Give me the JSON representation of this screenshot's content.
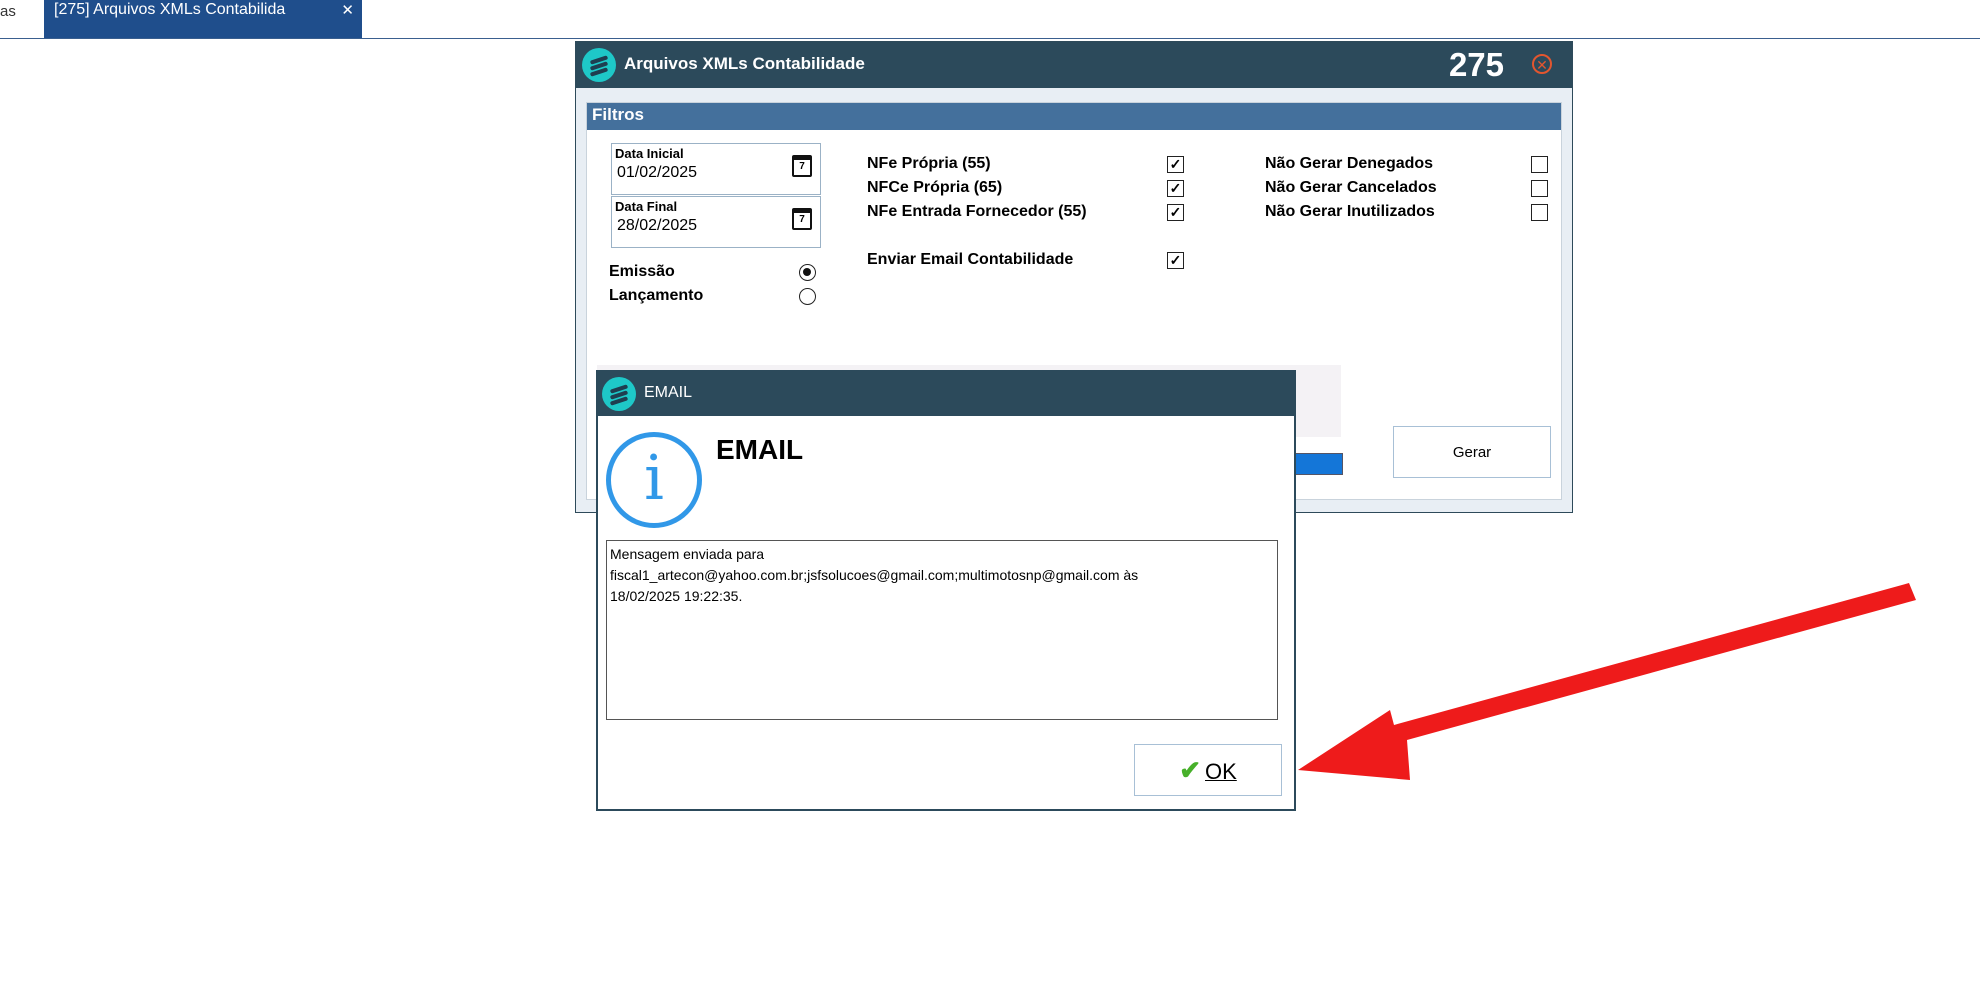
{
  "tabs": {
    "previous_label": "as",
    "active_label": "[275] Arquivos XMLs Contabilida",
    "close_glyph": "✕"
  },
  "window": {
    "title": "Arquivos XMLs Contabilidade",
    "code": "275",
    "close_glyph": "✕"
  },
  "filters": {
    "header": "Filtros",
    "data_inicial": {
      "label": "Data Inicial",
      "value": "01/02/2025"
    },
    "data_final": {
      "label": "Data Final",
      "value": "28/02/2025"
    },
    "calendar_day": "7",
    "date_type": [
      {
        "label": "Emissão",
        "selected": true
      },
      {
        "label": "Lançamento",
        "selected": false
      }
    ],
    "document_types": [
      {
        "label": "NFe Própria (55)",
        "checked": true
      },
      {
        "label": "NFCe Própria (65)",
        "checked": true
      },
      {
        "label": "NFe Entrada Fornecedor (55)",
        "checked": true
      }
    ],
    "send_email": {
      "label": "Enviar Email Contabilidade",
      "checked": true
    },
    "exclusions": [
      {
        "label": "Não Gerar Denegados",
        "checked": false
      },
      {
        "label": "Não Gerar Cancelados",
        "checked": false
      },
      {
        "label": "Não Gerar Inutilizados",
        "checked": false
      }
    ],
    "check_glyph": "✓",
    "generate_button": "Gerar"
  },
  "dialog": {
    "title": "EMAIL",
    "heading": "EMAIL",
    "info_glyph": "i",
    "message_lines": [
      "Mensagem enviada para",
      "fiscal1_artecon@yahoo.com.br;jsfsolucoes@gmail.com;multimotosnp@gmail.com às",
      "18/02/2025 19:22:35."
    ],
    "ok_check": "✔",
    "ok_label": "OK"
  },
  "colors": {
    "titlebar": "#2c4a5b",
    "section_header": "#44709c",
    "tab_active": "#1f4e8c",
    "logo": "#1ec8c8",
    "info_icon": "#3198e8",
    "ok_check": "#47b02a",
    "arrow": "#ee1b1b",
    "close_icon": "#e2562f"
  }
}
